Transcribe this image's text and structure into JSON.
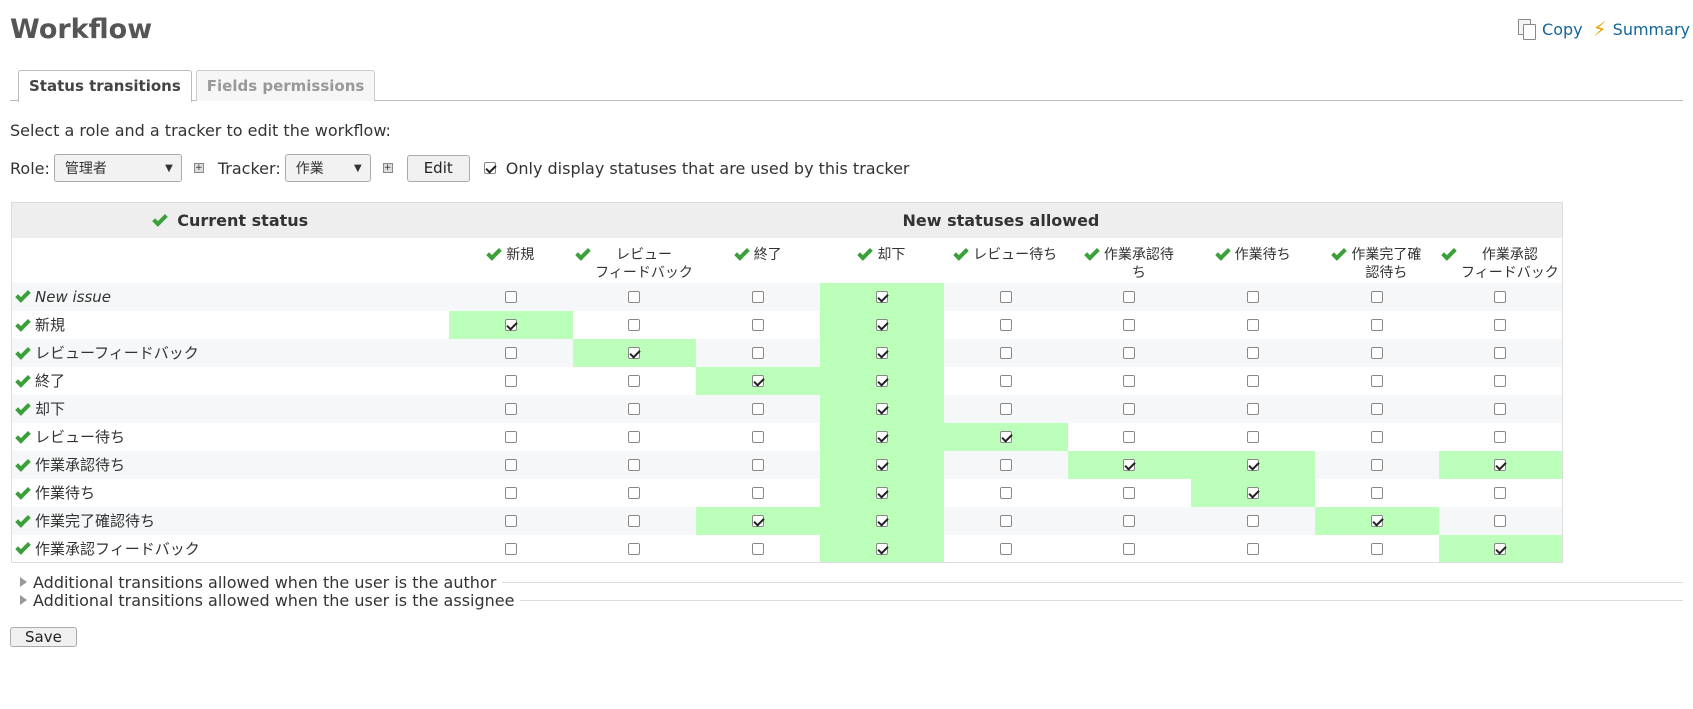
{
  "page_title": "Workflow",
  "contextual": {
    "copy_label": "Copy",
    "summary_label": "Summary"
  },
  "tabs": [
    {
      "label": "Status transitions",
      "selected": true
    },
    {
      "label": "Fields permissions",
      "selected": false
    }
  ],
  "instructions": "Select a role and a tracker to edit the workflow:",
  "filters": {
    "role_label": "Role:",
    "role_value": "管理者",
    "tracker_label": "Tracker:",
    "tracker_value": "作業",
    "edit_label": "Edit",
    "only_used_label": "Only display statuses that are used by this tracker",
    "only_used_checked": true
  },
  "table": {
    "current_status_header": "Current status",
    "new_statuses_header": "New statuses allowed",
    "columns": [
      [
        "新規"
      ],
      [
        "レビュー",
        "フィードバック"
      ],
      [
        "終了"
      ],
      [
        "却下"
      ],
      [
        "レビュー待ち"
      ],
      [
        "作業承認待",
        "ち"
      ],
      [
        "作業待ち"
      ],
      [
        "作業完了確",
        "認待ち"
      ],
      [
        "作業承認",
        "フィードバック"
      ]
    ],
    "rows": [
      {
        "name": "New issue",
        "italic": true,
        "checked": [
          0,
          0,
          0,
          1,
          0,
          0,
          0,
          0,
          0
        ],
        "highlight": [
          0,
          0,
          0,
          1,
          0,
          0,
          0,
          0,
          0
        ]
      },
      {
        "name": "新規",
        "italic": false,
        "checked": [
          1,
          0,
          0,
          1,
          0,
          0,
          0,
          0,
          0
        ],
        "highlight": [
          1,
          0,
          0,
          1,
          0,
          0,
          0,
          0,
          0
        ]
      },
      {
        "name": "レビューフィードバック",
        "italic": false,
        "checked": [
          0,
          1,
          0,
          1,
          0,
          0,
          0,
          0,
          0
        ],
        "highlight": [
          0,
          1,
          0,
          1,
          0,
          0,
          0,
          0,
          0
        ]
      },
      {
        "name": "終了",
        "italic": false,
        "checked": [
          0,
          0,
          1,
          1,
          0,
          0,
          0,
          0,
          0
        ],
        "highlight": [
          0,
          0,
          1,
          1,
          0,
          0,
          0,
          0,
          0
        ]
      },
      {
        "name": "却下",
        "italic": false,
        "checked": [
          0,
          0,
          0,
          1,
          0,
          0,
          0,
          0,
          0
        ],
        "highlight": [
          0,
          0,
          0,
          1,
          0,
          0,
          0,
          0,
          0
        ]
      },
      {
        "name": "レビュー待ち",
        "italic": false,
        "checked": [
          0,
          0,
          0,
          1,
          1,
          0,
          0,
          0,
          0
        ],
        "highlight": [
          0,
          0,
          0,
          1,
          1,
          0,
          0,
          0,
          0
        ]
      },
      {
        "name": "作業承認待ち",
        "italic": false,
        "checked": [
          0,
          0,
          0,
          1,
          0,
          1,
          1,
          0,
          1
        ],
        "highlight": [
          0,
          0,
          0,
          1,
          0,
          1,
          1,
          0,
          1
        ]
      },
      {
        "name": "作業待ち",
        "italic": false,
        "checked": [
          0,
          0,
          0,
          1,
          0,
          0,
          1,
          0,
          0
        ],
        "highlight": [
          0,
          0,
          0,
          1,
          0,
          0,
          1,
          0,
          0
        ]
      },
      {
        "name": "作業完了確認待ち",
        "italic": false,
        "checked": [
          0,
          0,
          1,
          1,
          0,
          0,
          0,
          1,
          0
        ],
        "highlight": [
          0,
          0,
          1,
          1,
          0,
          0,
          0,
          1,
          0
        ]
      },
      {
        "name": "作業承認フィードバック",
        "italic": false,
        "checked": [
          0,
          0,
          0,
          1,
          0,
          0,
          0,
          0,
          1
        ],
        "highlight": [
          0,
          0,
          0,
          1,
          0,
          0,
          0,
          0,
          1
        ]
      }
    ]
  },
  "collapsed_sections": [
    "Additional transitions allowed when the user is the author",
    "Additional transitions allowed when the user is the assignee"
  ],
  "save_label": "Save",
  "colors": {
    "highlight": "#bbffbb",
    "link": "#116699",
    "check_green": "#3aa03a"
  },
  "icons": {
    "copy": "copy-icon",
    "summary": "lightning-icon",
    "check": "green-check-icon",
    "expand": "triangle-right-icon"
  }
}
